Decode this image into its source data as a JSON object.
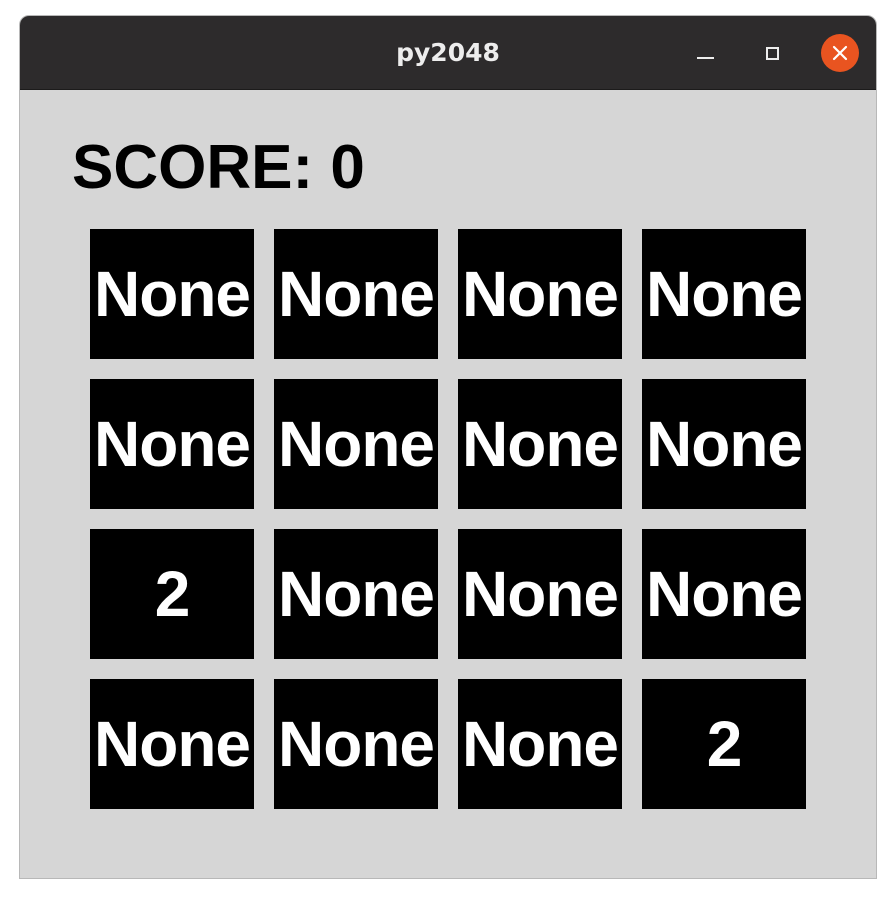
{
  "window": {
    "title": "py2048"
  },
  "titlebar": {
    "buttons": [
      {
        "name": "minimize",
        "icon": "minimize-icon"
      },
      {
        "name": "maximize",
        "icon": "maximize-icon"
      },
      {
        "name": "close",
        "icon": "close-icon",
        "color": "#e95420"
      }
    ]
  },
  "score": {
    "text": "SCORE: 0"
  },
  "board": {
    "rows": [
      [
        "None",
        "None",
        "None",
        "None"
      ],
      [
        "None",
        "None",
        "None",
        "None"
      ],
      [
        "2",
        "None",
        "None",
        "None"
      ],
      [
        "None",
        "None",
        "None",
        "2"
      ]
    ]
  },
  "colors": {
    "titlebar": "#2d2b2c",
    "background": "#d6d6d6",
    "tile": "#000000",
    "tile_text": "#ffffff",
    "close_button": "#e95420"
  }
}
